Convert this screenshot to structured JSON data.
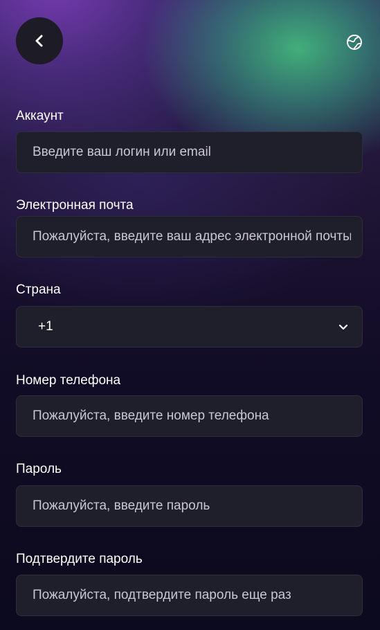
{
  "header": {
    "back_icon": "chevron-left-icon",
    "language_icon": "globe-icon"
  },
  "form": {
    "account": {
      "label": "Аккаунт",
      "placeholder": "Введите ваш логин или email"
    },
    "email": {
      "label": "Электронная почта",
      "placeholder": "Пожалуйста, введите ваш адрес электронной почты"
    },
    "country": {
      "label": "Страна",
      "value": "+1"
    },
    "phone": {
      "label": "Номер телефона",
      "placeholder": "Пожалуйста, введите номер телефона"
    },
    "password": {
      "label": "Пароль",
      "placeholder": "Пожалуйста, введите пароль"
    },
    "confirm_password": {
      "label": "Подтвердите пароль",
      "placeholder": "Пожалуйста, подтвердите пароль еще раз"
    }
  },
  "colors": {
    "input_bg": "#1f1e2b",
    "back_button_bg": "#1c1b26",
    "text": "#ffffff",
    "placeholder": "#c9c7d2"
  }
}
